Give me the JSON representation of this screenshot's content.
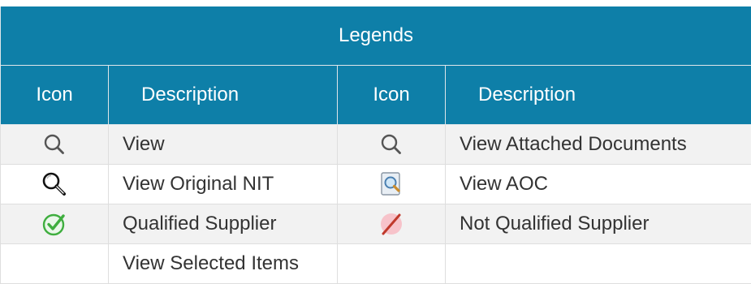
{
  "legend": {
    "title": "Legends",
    "columns": {
      "icon_1": "Icon",
      "description_1": "Description",
      "icon_2": "Icon",
      "description_2": "Description"
    },
    "rows": [
      {
        "left": {
          "icon": "magnifier-icon",
          "description": "View"
        },
        "right": {
          "icon": "magnifier-icon",
          "description": "View Attached Documents"
        }
      },
      {
        "left": {
          "icon": "magnifying-glass-icon",
          "description": "View Original NIT"
        },
        "right": {
          "icon": "document-preview-icon",
          "description": "View AOC"
        }
      },
      {
        "left": {
          "icon": "check-circle-icon",
          "description": "Qualified Supplier"
        },
        "right": {
          "icon": "not-allowed-icon",
          "description": "Not Qualified Supplier"
        }
      },
      {
        "left": {
          "icon": "",
          "description": "View Selected Items"
        },
        "right": {
          "icon": "",
          "description": ""
        }
      }
    ]
  },
  "colors": {
    "header_bg": "#0e7fa8",
    "header_text": "#ffffff",
    "row_shaded": "#f2f2f2",
    "check_green": "#3fae3f",
    "not_qualified_red": "#c0392b"
  }
}
